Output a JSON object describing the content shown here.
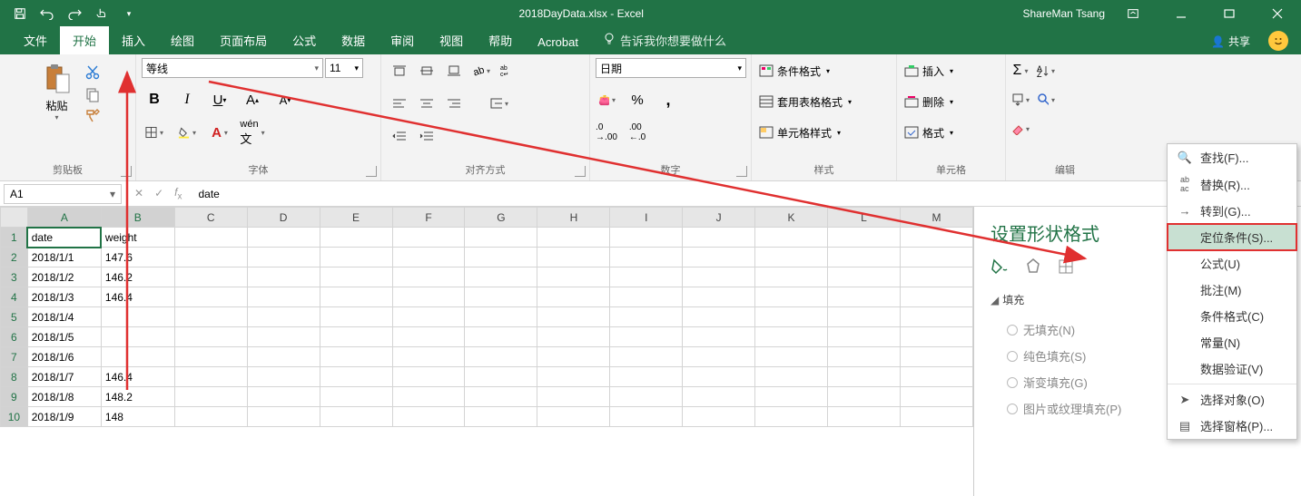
{
  "titlebar": {
    "filename": "2018DayData.xlsx  -  Excel",
    "user": "ShareMan Tsang"
  },
  "tabs": {
    "file": "文件",
    "home": "开始",
    "insert": "插入",
    "draw": "绘图",
    "page_layout": "页面布局",
    "formulas": "公式",
    "data": "数据",
    "review": "审阅",
    "view": "视图",
    "help": "帮助",
    "acrobat": "Acrobat",
    "tell_me": "告诉我你想要做什么",
    "share": "共享"
  },
  "ribbon": {
    "clipboard": {
      "label": "剪贴板",
      "paste": "粘贴"
    },
    "font": {
      "label": "字体",
      "name": "等线",
      "size": "11"
    },
    "alignment": {
      "label": "对齐方式"
    },
    "number": {
      "label": "数字",
      "format": "日期"
    },
    "styles": {
      "label": "样式",
      "conditional": "条件格式",
      "table": "套用表格格式",
      "cell": "单元格样式"
    },
    "cells": {
      "label": "单元格",
      "insert": "插入",
      "delete": "删除",
      "format": "格式"
    },
    "editing": {
      "label": "编辑"
    }
  },
  "formula_bar": {
    "name_box": "A1",
    "formula": "date"
  },
  "columns": [
    "A",
    "B",
    "C",
    "D",
    "E",
    "F",
    "G",
    "H",
    "I",
    "J",
    "K",
    "L",
    "M"
  ],
  "rows": [
    {
      "n": 1,
      "a": "date",
      "b": "weight"
    },
    {
      "n": 2,
      "a": "2018/1/1",
      "b": "147.6"
    },
    {
      "n": 3,
      "a": "2018/1/2",
      "b": "146.2"
    },
    {
      "n": 4,
      "a": "2018/1/3",
      "b": "146.4"
    },
    {
      "n": 5,
      "a": "2018/1/4",
      "b": ""
    },
    {
      "n": 6,
      "a": "2018/1/5",
      "b": ""
    },
    {
      "n": 7,
      "a": "2018/1/6",
      "b": ""
    },
    {
      "n": 8,
      "a": "2018/1/7",
      "b": "146.4"
    },
    {
      "n": 9,
      "a": "2018/1/8",
      "b": "148.2"
    },
    {
      "n": 10,
      "a": "2018/1/9",
      "b": "148"
    }
  ],
  "side_panel": {
    "title": "设置形状格式",
    "section": "填充",
    "options": {
      "none": "无填充(N)",
      "solid": "纯色填充(S)",
      "gradient": "渐变填充(G)",
      "picture": "图片或纹理填充(P)"
    }
  },
  "find_menu": {
    "find": "查找(F)...",
    "replace": "替换(R)...",
    "goto": "转到(G)...",
    "goto_special": "定位条件(S)...",
    "formulas": "公式(U)",
    "comments": "批注(M)",
    "cond_fmt": "条件格式(C)",
    "constants": "常量(N)",
    "data_val": "数据验证(V)",
    "sel_objects": "选择对象(O)",
    "sel_pane": "选择窗格(P)..."
  },
  "chart_data": {
    "type": "table",
    "title": "2018DayData",
    "columns": [
      "date",
      "weight"
    ],
    "rows": [
      [
        "2018/1/1",
        147.6
      ],
      [
        "2018/1/2",
        146.2
      ],
      [
        "2018/1/3",
        146.4
      ],
      [
        "2018/1/4",
        null
      ],
      [
        "2018/1/5",
        null
      ],
      [
        "2018/1/6",
        null
      ],
      [
        "2018/1/7",
        146.4
      ],
      [
        "2018/1/8",
        148.2
      ],
      [
        "2018/1/9",
        148
      ]
    ]
  }
}
